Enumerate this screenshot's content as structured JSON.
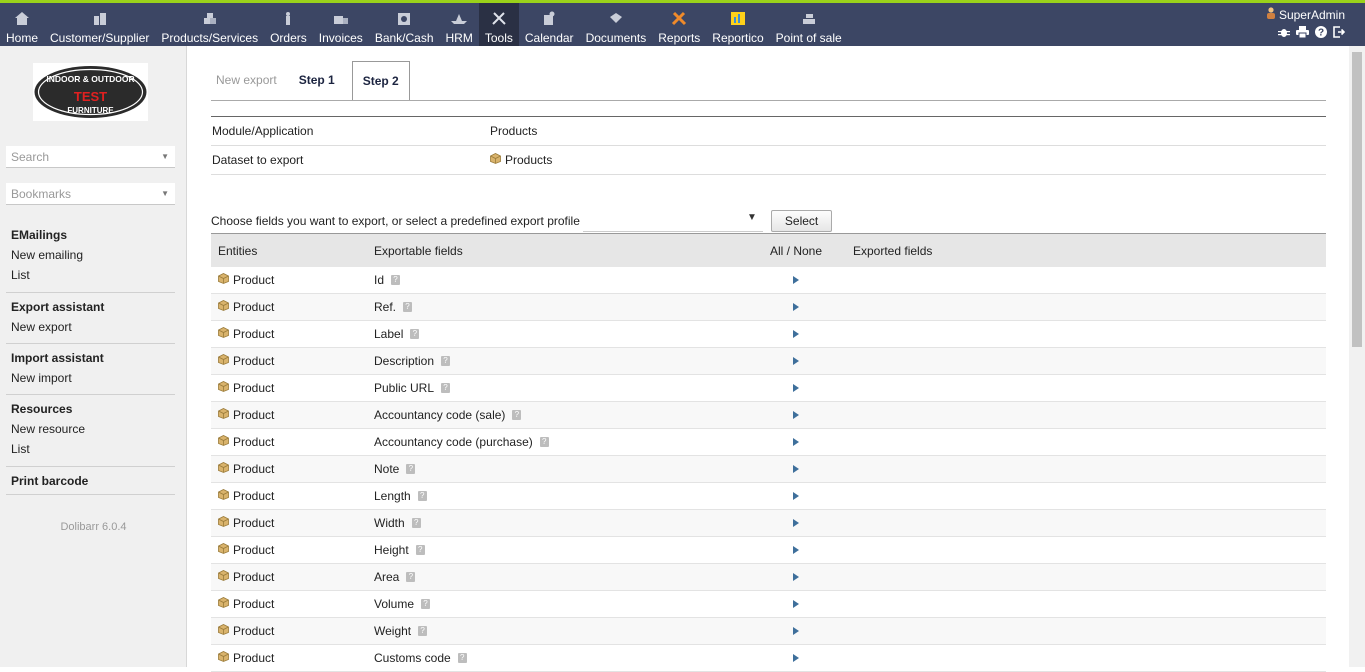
{
  "topmenu": [
    {
      "label": "Home",
      "icon": "home-icon"
    },
    {
      "label": "Customer/Supplier",
      "icon": "company-icon"
    },
    {
      "label": "Products/Services",
      "icon": "product-icon"
    },
    {
      "label": "Orders",
      "icon": "orders-icon"
    },
    {
      "label": "Invoices",
      "icon": "invoices-icon"
    },
    {
      "label": "Bank/Cash",
      "icon": "bank-icon"
    },
    {
      "label": "HRM",
      "icon": "hrm-icon"
    },
    {
      "label": "Tools",
      "icon": "tools-icon",
      "active": true
    },
    {
      "label": "Calendar",
      "icon": "calendar-icon"
    },
    {
      "label": "Documents",
      "icon": "documents-icon"
    },
    {
      "label": "Reports",
      "icon": "reports-icon"
    },
    {
      "label": "Reportico",
      "icon": "reportico-icon"
    },
    {
      "label": "Point of sale",
      "icon": "pos-icon"
    }
  ],
  "user": {
    "name": "SuperAdmin"
  },
  "sidebar": {
    "search_placeholder": "Search",
    "bookmarks_placeholder": "Bookmarks",
    "emailings": {
      "title": "EMailings",
      "links": [
        "New emailing",
        "List"
      ]
    },
    "export": {
      "title": "Export assistant",
      "links": [
        "New export"
      ]
    },
    "import": {
      "title": "Import assistant",
      "links": [
        "New import"
      ]
    },
    "resources": {
      "title": "Resources",
      "links": [
        "New resource",
        "List"
      ]
    },
    "barcode": {
      "title": "Print barcode"
    },
    "version": "Dolibarr 6.0.4"
  },
  "tabs": [
    "New export",
    "Step 1",
    "Step 2"
  ],
  "info": {
    "module_label": "Module/Application",
    "module_value": "Products",
    "dataset_label": "Dataset to export",
    "dataset_value": "Products"
  },
  "profile": {
    "label": "Choose fields you want to export, or select a predefined export profile",
    "button": "Select"
  },
  "grid": {
    "headers": {
      "entities": "Entities",
      "fields": "Exportable fields",
      "allnone": "All / None",
      "exported": "Exported fields"
    },
    "rows": [
      {
        "entity": "Product",
        "field": "Id"
      },
      {
        "entity": "Product",
        "field": "Ref."
      },
      {
        "entity": "Product",
        "field": "Label"
      },
      {
        "entity": "Product",
        "field": "Description"
      },
      {
        "entity": "Product",
        "field": "Public URL"
      },
      {
        "entity": "Product",
        "field": "Accountancy code (sale)"
      },
      {
        "entity": "Product",
        "field": "Accountancy code (purchase)"
      },
      {
        "entity": "Product",
        "field": "Note"
      },
      {
        "entity": "Product",
        "field": "Length"
      },
      {
        "entity": "Product",
        "field": "Width"
      },
      {
        "entity": "Product",
        "field": "Height"
      },
      {
        "entity": "Product",
        "field": "Area"
      },
      {
        "entity": "Product",
        "field": "Volume"
      },
      {
        "entity": "Product",
        "field": "Weight"
      },
      {
        "entity": "Product",
        "field": "Customs code"
      }
    ]
  },
  "logo": {
    "line1": "INDOOR & OUTDOOR",
    "line2": "TEST",
    "line3": "FURNITURE"
  }
}
